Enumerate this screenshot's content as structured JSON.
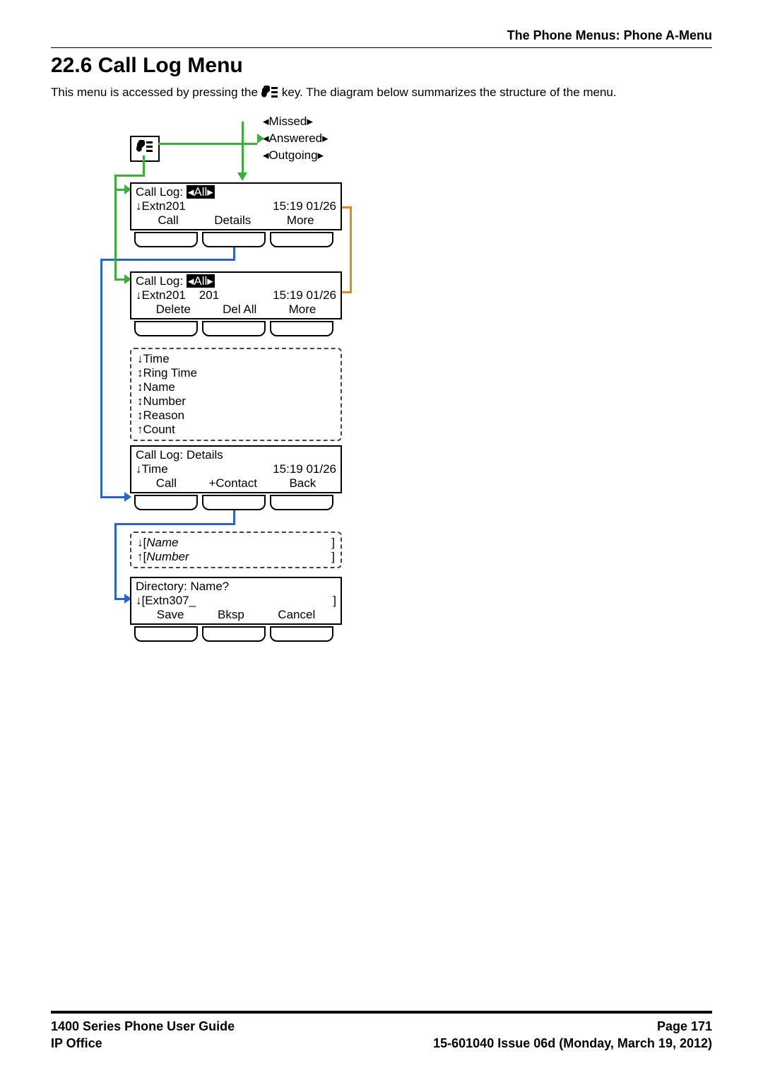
{
  "header": {
    "breadcrumb": "The Phone Menus: Phone A-Menu"
  },
  "section": {
    "title": "22.6 Call Log Menu",
    "intro_before": "This menu is accessed by pressing the",
    "intro_after": "key. The diagram below summarizes the structure of the menu."
  },
  "diagram": {
    "filters": {
      "missed": "◂Missed▸",
      "answered": "◂Answered▸",
      "outgoing": "◂Outgoing▸"
    },
    "all_tag": "◂All▸",
    "screen1": {
      "title_prefix": "Call Log:",
      "row2_left": "↓Extn201",
      "row2_right": "15:19 01/26",
      "sk1": "Call",
      "sk2": "Details",
      "sk3": "More"
    },
    "screen2": {
      "title_prefix": "Call Log:",
      "row2_left": "↓Extn201",
      "row2_mid": "201",
      "row2_right": "15:19 01/26",
      "sk1": "Delete",
      "sk2": "Del All",
      "sk3": "More"
    },
    "details_list": [
      "↓Time",
      "↕Ring Time",
      "↕Name",
      "↕Number",
      "↕Reason",
      "↑Count"
    ],
    "screen3": {
      "title": "Call Log: Details",
      "row2_left": "↓Time",
      "row2_right": "15:19  01/26",
      "sk1": "Call",
      "sk2": "+Contact",
      "sk3": "Back"
    },
    "name_number_box": {
      "line1_pre": "↓[",
      "line1_name": "Name",
      "line2_pre": "↑[",
      "line2_name": "Number",
      "close": "]"
    },
    "screen4": {
      "title": "Directory: Name?",
      "row2_left": "↓[Extn307_",
      "row2_right": "]",
      "sk1": "Save",
      "sk2": "Bksp",
      "sk3": "Cancel"
    }
  },
  "footer": {
    "left1": "1400 Series Phone User Guide",
    "right1": "Page 171",
    "left2": "IP Office",
    "right2": "15-601040 Issue 06d (Monday, March 19, 2012)"
  }
}
